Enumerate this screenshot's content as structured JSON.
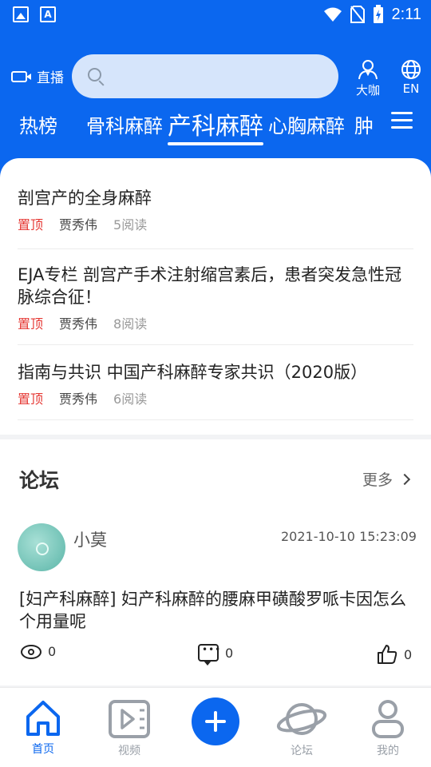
{
  "status_bar": {
    "time": "2:11",
    "a_badge": "A"
  },
  "header": {
    "live_label": "直播",
    "search": {
      "placeholder": ""
    },
    "expert_label": "大咖",
    "language_label": "EN"
  },
  "tabs": [
    {
      "label": "热榜"
    },
    {
      "label": "骨科麻醉"
    },
    {
      "label": "产科麻醉",
      "active": true
    },
    {
      "label": "心胸麻醉"
    },
    {
      "label": "肿"
    }
  ],
  "articles": [
    {
      "title": "剖宫产的全身麻醉",
      "pin": "置顶",
      "author": "贾秀伟",
      "reads": "5阅读"
    },
    {
      "title": "EJA专栏  剖宫产手术注射缩宫素后，患者突发急性冠脉综合征！",
      "pin": "置顶",
      "author": "贾秀伟",
      "reads": "8阅读"
    },
    {
      "title": "指南与共识  中国产科麻醉专家共识（2020版）",
      "pin": "置顶",
      "author": "贾秀伟",
      "reads": "6阅读"
    }
  ],
  "forum": {
    "heading": "论坛",
    "more_label": "更多",
    "post": {
      "user": "小莫",
      "time": "2021-10-10 15:23:09",
      "title": "[妇产科麻醉] 妇产科麻醉的腰麻甲磺酸罗哌卡因怎么个用量呢",
      "views": "0",
      "comments": "0",
      "likes": "0"
    }
  },
  "bottom_nav": [
    {
      "label": "首页",
      "active": true
    },
    {
      "label": "视频"
    },
    {
      "label": "论坛"
    },
    {
      "label": "我的"
    }
  ],
  "colors": {
    "brand": "#0b67ef",
    "pin": "#e53935"
  }
}
